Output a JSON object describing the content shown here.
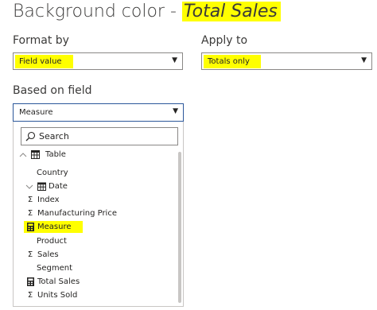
{
  "header": {
    "prefix": "Background color - ",
    "highlight": "Total Sales"
  },
  "format_by": {
    "label": "Format by",
    "value": "Field value"
  },
  "apply_to": {
    "label": "Apply to",
    "value": "Totals only"
  },
  "based_on": {
    "label": "Based on field",
    "value": "Measure"
  },
  "search": {
    "placeholder": "Search"
  },
  "tree": {
    "table": "Table",
    "items": [
      {
        "label": "Country",
        "icon": "none"
      },
      {
        "label": "Date",
        "icon": "calendar-icon"
      },
      {
        "label": "Index",
        "icon": "sigma-icon"
      },
      {
        "label": "Manufacturing Price",
        "icon": "sigma-icon"
      },
      {
        "label": "Measure",
        "icon": "calculator-icon"
      },
      {
        "label": "Product",
        "icon": "none"
      },
      {
        "label": "Sales",
        "icon": "sigma-icon"
      },
      {
        "label": "Segment",
        "icon": "none"
      },
      {
        "label": "Total Sales",
        "icon": "calculator-icon"
      },
      {
        "label": "Units Sold",
        "icon": "sigma-icon"
      }
    ]
  },
  "colors": {
    "highlight": "#ffff00",
    "border": "#8a8886",
    "focus": "#2b579a"
  }
}
